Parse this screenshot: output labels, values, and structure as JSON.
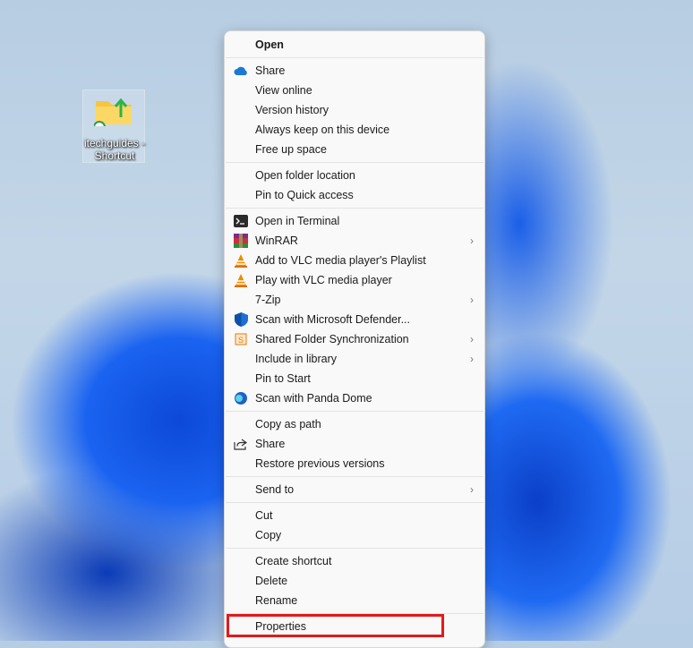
{
  "desktop": {
    "shortcut_label": "itechguides - Shortcut"
  },
  "menu": [
    [
      {
        "label": "Open",
        "bold": true
      }
    ],
    [
      {
        "label": "Share",
        "icon": "onedrive-cloud-icon"
      },
      {
        "label": "View online"
      },
      {
        "label": "Version history"
      },
      {
        "label": "Always keep on this device"
      },
      {
        "label": "Free up space"
      }
    ],
    [
      {
        "label": "Open folder location"
      },
      {
        "label": "Pin to Quick access"
      }
    ],
    [
      {
        "label": "Open in Terminal",
        "icon": "terminal-icon"
      },
      {
        "label": "WinRAR",
        "icon": "winrar-icon",
        "submenu": true
      },
      {
        "label": "Add to VLC media player's Playlist",
        "icon": "vlc-icon"
      },
      {
        "label": "Play with VLC media player",
        "icon": "vlc-icon"
      },
      {
        "label": "7-Zip",
        "submenu": true
      },
      {
        "label": "Scan with Microsoft Defender...",
        "icon": "defender-shield-icon"
      },
      {
        "label": "Shared Folder Synchronization",
        "icon": "sync-icon",
        "submenu": true
      },
      {
        "label": "Include in library",
        "submenu": true
      },
      {
        "label": "Pin to Start"
      },
      {
        "label": "Scan with Panda Dome",
        "icon": "panda-dome-icon"
      }
    ],
    [
      {
        "label": "Copy as path"
      },
      {
        "label": "Share",
        "icon": "share-icon"
      },
      {
        "label": "Restore previous versions"
      }
    ],
    [
      {
        "label": "Send to",
        "submenu": true
      }
    ],
    [
      {
        "label": "Cut"
      },
      {
        "label": "Copy"
      }
    ],
    [
      {
        "label": "Create shortcut"
      },
      {
        "label": "Delete"
      },
      {
        "label": "Rename"
      }
    ],
    [
      {
        "label": "Properties",
        "highlighted": true
      }
    ]
  ],
  "colors": {
    "highlight": "#e01b1b"
  }
}
